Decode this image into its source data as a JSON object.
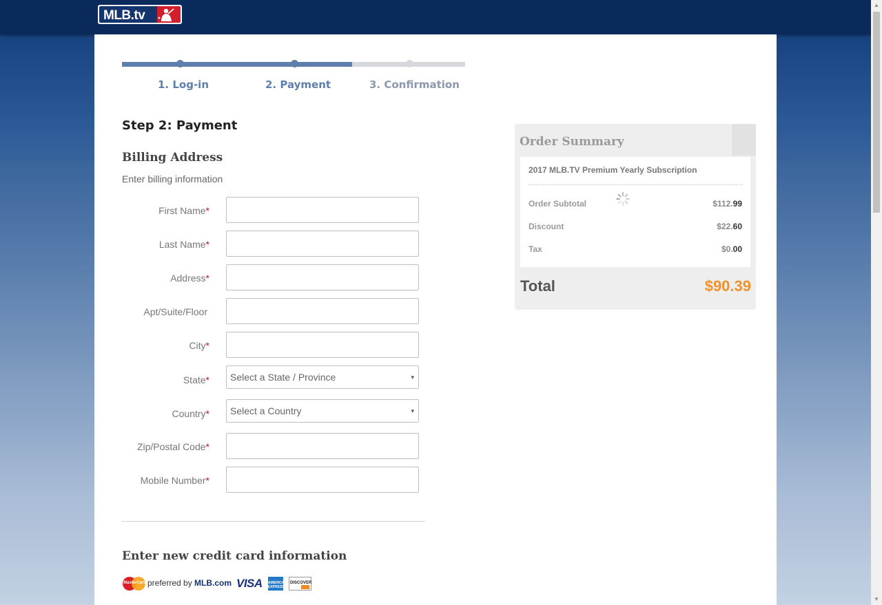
{
  "header": {
    "logo_text": "MLB.tv"
  },
  "colors": {
    "brand_navy": "#0a2a5c",
    "brand_red": "#d11f2c",
    "progress_active": "#5e7fac",
    "total_accent": "#f1922a"
  },
  "progress": {
    "completed_fraction": 0.67,
    "steps": [
      {
        "label": "1. Log-in",
        "state": "done"
      },
      {
        "label": "2. Payment",
        "state": "current"
      },
      {
        "label": "3. Confirmation",
        "state": "todo"
      }
    ]
  },
  "main": {
    "step_title": "Step 2: Payment",
    "billing_title": "Billing Address",
    "billing_subtitle": "Enter billing information",
    "required_marker": "*",
    "fields": {
      "first_name": {
        "label": "First Name",
        "value": ""
      },
      "last_name": {
        "label": "Last Name",
        "value": ""
      },
      "address": {
        "label": "Address",
        "value": ""
      },
      "apt": {
        "label": "Apt/Suite/Floor",
        "value": ""
      },
      "city": {
        "label": "City",
        "value": ""
      },
      "state": {
        "label": "State",
        "selected": "Select a State / Province"
      },
      "country": {
        "label": "Country",
        "selected": "Select a Country"
      },
      "zip": {
        "label": "Zip/Postal Code",
        "value": ""
      },
      "mobile": {
        "label": "Mobile Number",
        "value": ""
      }
    },
    "credit_card_title": "Enter new credit card information",
    "cards": {
      "mastercard_text": "MasterCard",
      "preferred_prefix": "preferred by ",
      "preferred_brand": "MLB.com",
      "visa_text": "VISA",
      "amex_text": "AMERICAN EXPRESS",
      "discover_text": "DISCOVER"
    }
  },
  "order_summary": {
    "title": "Order Summary",
    "item": "2017 MLB.TV Premium Yearly Subscription",
    "lines": {
      "subtotal": {
        "label": "Order Subtotal",
        "dollars": "$112.",
        "cents": "99"
      },
      "discount": {
        "label": "Discount",
        "dollars": "$22.",
        "cents": "60"
      },
      "tax": {
        "label": "Tax",
        "dollars": "$0.",
        "cents": "00"
      }
    },
    "total_label": "Total",
    "total_value": "$90.39"
  },
  "icons": {
    "caret": "▾",
    "scroll_up": "▲",
    "scroll_down": "▼"
  }
}
